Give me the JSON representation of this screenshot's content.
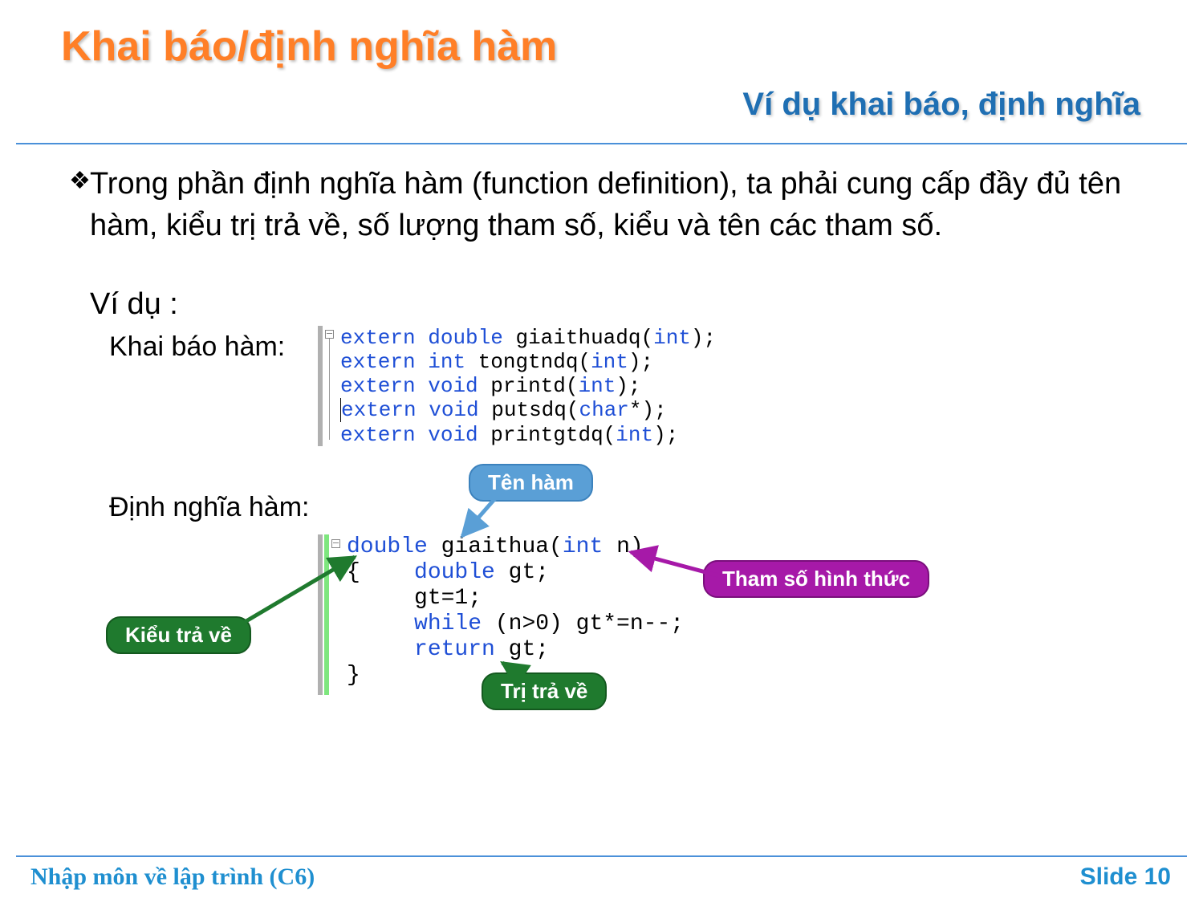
{
  "title": "Khai báo/định nghĩa hàm",
  "subtitle": "Ví dụ khai báo, định nghĩa",
  "bullet_glyph": "❖",
  "body_paragraph": "Trong phần định nghĩa hàm (function definition), ta phải cung cấp đầy đủ tên hàm, kiểu trị trả về, số lượng tham số, kiểu và tên các tham số.",
  "example_prefix": "Ví dụ :",
  "labels": {
    "declare": "Khai báo hàm:",
    "define": "Định nghĩa hàm:"
  },
  "code_declarations": {
    "lines": [
      {
        "kw1": "extern",
        "kw2": "double",
        "tail": " giaithuadq(",
        "kw3": "int",
        "end": ");"
      },
      {
        "kw1": "extern",
        "kw2": "int",
        "tail": " tongtndq(",
        "kw3": "int",
        "end": ");"
      },
      {
        "kw1": "extern",
        "kw2": "void",
        "tail": " printd(",
        "kw3": "int",
        "end": ");"
      },
      {
        "kw1": "extern",
        "kw2": "void",
        "tail": " putsdq(",
        "kw3": "char",
        "end": "*);",
        "cursor": true
      },
      {
        "kw1": "extern",
        "kw2": "void",
        "tail": " printgtdq(",
        "kw3": "int",
        "end": ");"
      }
    ]
  },
  "code_definition": {
    "line1_kw": "double",
    "line1_name": " giaithua(",
    "line1_param_kw": "int",
    "line1_param_end": " n)",
    "line2_open": "{    ",
    "line2_kw": "double",
    "line2_end": " gt;",
    "line3": "     gt=1;",
    "line4_a": "     ",
    "line4_kw": "while",
    "line4_b": " (n>0) gt*=n--;",
    "line5_a": "     ",
    "line5_kw": "return",
    "line5_b": " gt;",
    "line6": "}"
  },
  "annotations": {
    "func_name": "Tên hàm",
    "formal_param": "Tham số hình thức",
    "return_type": "Kiểu trả về",
    "return_value": "Trị trả về"
  },
  "footer": {
    "left": "Nhập môn về lập trình (C6)",
    "right_prefix": "Slide ",
    "slide_number": "10"
  },
  "colors": {
    "title_orange": "#ff7f27",
    "subtitle_blue": "#1f6fb3",
    "keyword_blue": "#1f4fd6",
    "pill_blue": "#5a9fd6",
    "pill_purple": "#a619a8",
    "pill_green": "#1f7a2e",
    "footer_blue": "#1f8fd0"
  }
}
